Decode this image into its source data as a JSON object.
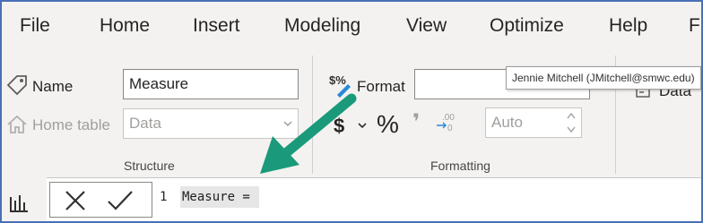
{
  "menu": {
    "items": [
      "File",
      "Home",
      "Insert",
      "Modeling",
      "View",
      "Optimize",
      "Help",
      "F"
    ]
  },
  "structure": {
    "name_label": "Name",
    "name_value": "Measure",
    "home_table_label": "Home table",
    "home_table_value": "Data",
    "group_label": "Structure"
  },
  "formatting": {
    "format_label": "Format",
    "format_value": "",
    "currency_symbol": "$",
    "percent_symbol": "%",
    "comma_symbol": "❜",
    "decimals_symbol": ".00",
    "decimal_places_value": "Auto",
    "group_label": "Formatting"
  },
  "properties": {
    "data_category_label": "Data"
  },
  "tooltip": {
    "text": "Jennie Mitchell (JMitchell@smwc.edu)"
  },
  "formula_bar": {
    "line_number": "1",
    "formula": "Measure = "
  },
  "colors": {
    "accent_arrow": "#1a9a7a",
    "frame_border": "#4a6fb5",
    "ribbon_background": "#f3f2f1"
  }
}
